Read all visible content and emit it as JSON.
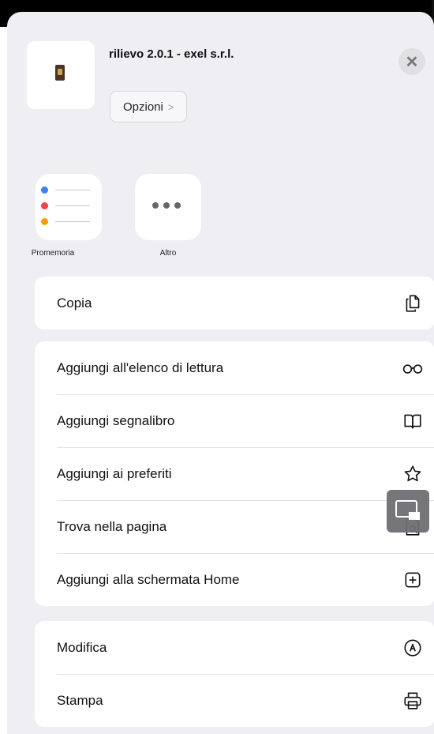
{
  "header": {
    "title": "rilievo 2.0.1 - exel s.r.l.",
    "options_label": "Opzioni",
    "options_chevron": ">",
    "close_symbol": "✕"
  },
  "apps": [
    {
      "label": "Promemoria",
      "icon": "reminders-icon"
    },
    {
      "label": "Altro",
      "icon": "more-icon"
    }
  ],
  "group1": [
    {
      "label": "Copia",
      "icon": "copy-icon"
    }
  ],
  "group2": [
    {
      "label": "Aggiungi all'elenco di lettura",
      "icon": "glasses-icon"
    },
    {
      "label": "Aggiungi segnalibro",
      "icon": "book-icon"
    },
    {
      "label": "Aggiungi ai preferiti",
      "icon": "star-icon"
    },
    {
      "label": "Trova nella pagina",
      "icon": "find-in-page-icon"
    },
    {
      "label": "Aggiungi alla schermata Home",
      "icon": "add-square-icon"
    }
  ],
  "group3": [
    {
      "label": "Modifica",
      "icon": "markup-icon"
    },
    {
      "label": "Stampa",
      "icon": "printer-icon"
    }
  ],
  "colors": {
    "reminder_blue": "#3b82f6",
    "reminder_red": "#ef4444",
    "reminder_orange": "#f59e0b"
  }
}
